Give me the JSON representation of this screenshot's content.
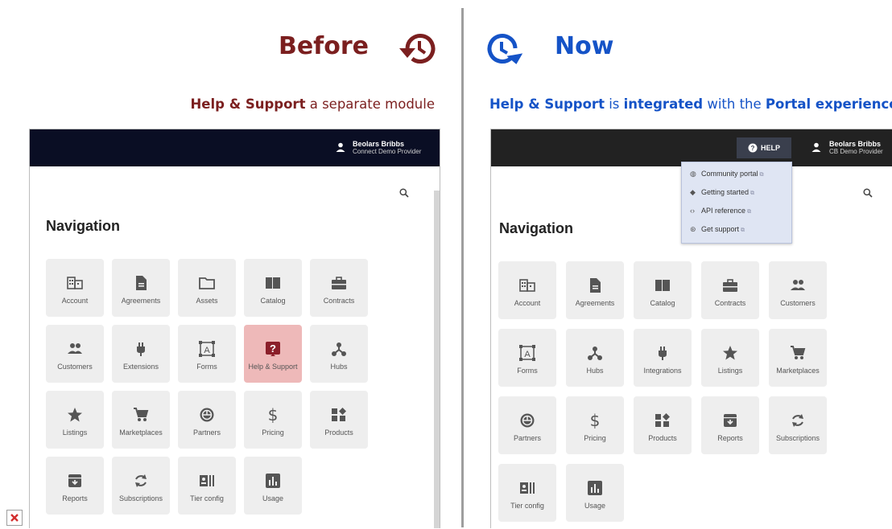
{
  "before": {
    "title": "Before",
    "caption_bold": "Help & Support",
    "caption_rest": " a separate module",
    "user": {
      "name": "Beolars Bribbs",
      "role": "Connect Demo Provider"
    },
    "heading": "Navigation",
    "tiles": [
      "Account",
      "Agreements",
      "Assets",
      "Catalog",
      "Contracts",
      "Customers",
      "Extensions",
      "Forms",
      "Help & Support",
      "Hubs",
      "Listings",
      "Marketplaces",
      "Partners",
      "Pricing",
      "Products",
      "Reports",
      "Subscriptions",
      "Tier config",
      "Usage"
    ]
  },
  "now": {
    "title": "Now",
    "caption_parts": [
      "Help & Support",
      " is ",
      "integrated",
      " with the ",
      "Portal experience"
    ],
    "user": {
      "name": "Beolars Bribbs",
      "role": "CB Demo Provider"
    },
    "help_label": "HELP",
    "help_menu": [
      "Community portal",
      "Getting started",
      "API reference",
      "Get support"
    ],
    "heading": "Navigation",
    "tiles": [
      "Account",
      "Agreements",
      "Catalog",
      "Contracts",
      "Customers",
      "Forms",
      "Hubs",
      "Integrations",
      "Listings",
      "Marketplaces",
      "Partners",
      "Pricing",
      "Products",
      "Reports",
      "Subscriptions",
      "Tier config",
      "Usage"
    ]
  },
  "colors": {
    "before_accent": "#7b1f1f",
    "now_accent": "#1553c7",
    "highlight": "#eeb9b9"
  }
}
